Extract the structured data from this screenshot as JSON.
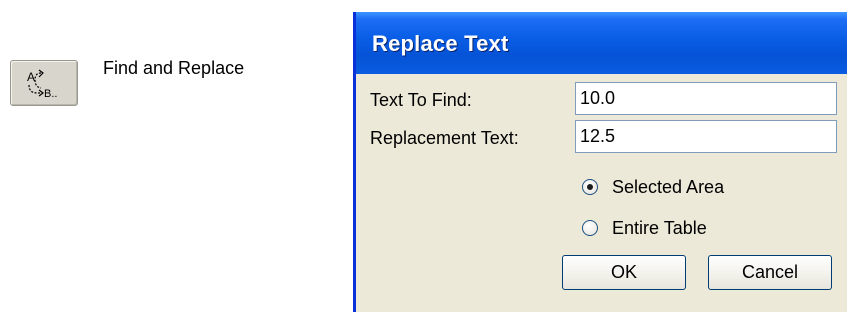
{
  "toolbar": {
    "find_replace_icon": "find-replace-icon",
    "icon_glyph_from": "A",
    "icon_glyph_to": "B..",
    "caption": "Find and Replace"
  },
  "dialog": {
    "title": "Replace Text",
    "text_to_find_label": "Text To Find:",
    "text_to_find_value": "10.0",
    "replacement_label": "Replacement Text:",
    "replacement_value": "12.5",
    "scope_options": [
      {
        "label": "Selected Area",
        "selected": true
      },
      {
        "label": "Entire Table",
        "selected": false
      }
    ],
    "ok_label": "OK",
    "cancel_label": "Cancel"
  },
  "colors": {
    "titlebar": "#0553d7",
    "dialog_face": "#ece9d8",
    "button_border": "#003c74"
  }
}
